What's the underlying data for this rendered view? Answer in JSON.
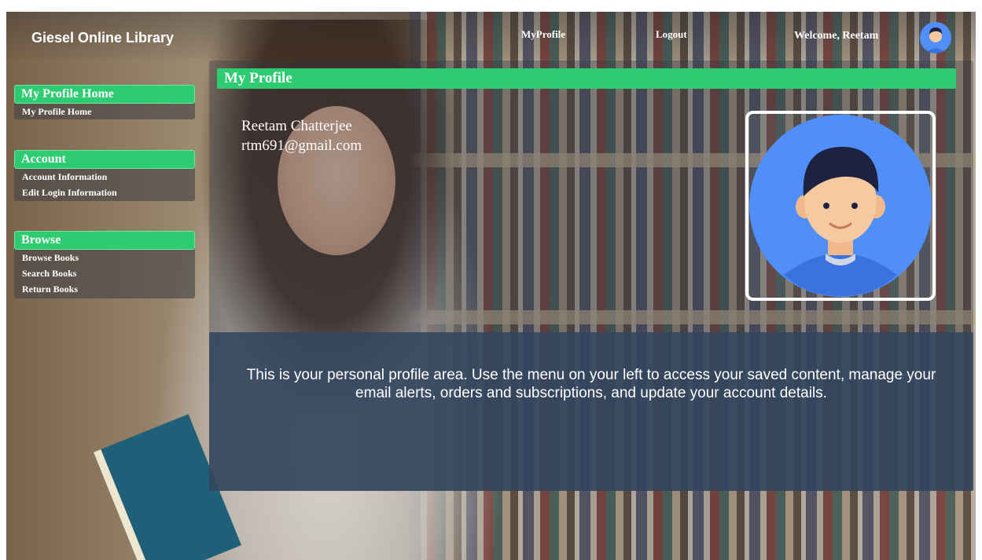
{
  "header": {
    "brand": "Giesel Online Library",
    "nav": {
      "my_profile": "MyProfile",
      "logout": "Logout"
    },
    "welcome": "Welcome, Reetam"
  },
  "sidebar": {
    "groups": [
      {
        "title": "My Profile Home",
        "items": [
          "My Profile Home"
        ]
      },
      {
        "title": "Account",
        "items": [
          "Account Information",
          "Edit Login Information"
        ]
      },
      {
        "title": "Browse",
        "items": [
          "Browse Books",
          "Search Books",
          "Return Books"
        ]
      }
    ]
  },
  "main": {
    "title": "My Profile",
    "user": {
      "name": "Reetam Chatterjee",
      "email": "rtm691@gmail.com"
    },
    "info": "This is your personal profile area. Use the menu on your left to access your saved content, manage your email alerts, orders and subscriptions, and update your account details."
  },
  "colors": {
    "accent": "#2ecc71",
    "avatar_bg": "#4f8ff7",
    "band": "#32465f"
  },
  "icons": {
    "avatar": "user-avatar-icon"
  }
}
